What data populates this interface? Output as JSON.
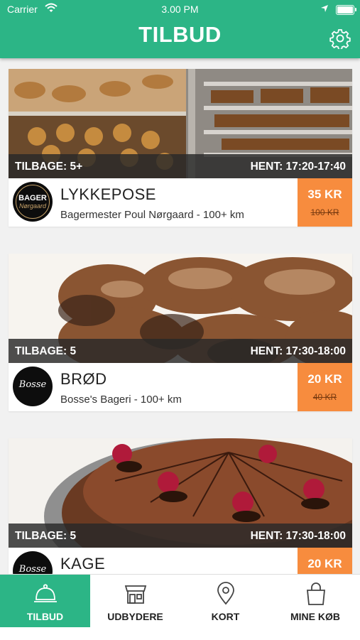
{
  "status_bar": {
    "carrier": "Carrier",
    "time": "3.00 PM"
  },
  "header": {
    "title": "TILBUD",
    "settings_icon": "gear-icon"
  },
  "colors": {
    "brand_green": "#2cb586",
    "price_orange": "#f78c3e"
  },
  "offers": [
    {
      "remaining": "TILBAGE: 5+",
      "pickup": "HENT: 17:20-17:40",
      "name": "LYKKEPOSE",
      "vendor": "Bagermester Poul Nørgaard - 100+ km",
      "logo_line1": "BAGER",
      "logo_line2": "Nørgaard",
      "price": "35 KR",
      "original_price": "100 KR"
    },
    {
      "remaining": "TILBAGE: 5",
      "pickup": "HENT: 17:30-18:00",
      "name": "BRØD",
      "vendor": "Bosse's Bageri - 100+ km",
      "logo_line1": "Bosse",
      "price": "20 KR",
      "original_price": "40 KR"
    },
    {
      "remaining": "TILBAGE: 5",
      "pickup": "HENT: 17:30-18:00",
      "name": "KAGE",
      "vendor": "",
      "logo_line1": "Bosse",
      "price": "20 KR",
      "original_price": ""
    }
  ],
  "tabs": [
    {
      "label": "TILBUD",
      "icon": "cloche-icon",
      "active": true
    },
    {
      "label": "UDBYDERE",
      "icon": "shop-icon",
      "active": false
    },
    {
      "label": "KORT",
      "icon": "map-pin-icon",
      "active": false
    },
    {
      "label": "MINE KØB",
      "icon": "shopping-bag-icon",
      "active": false
    }
  ]
}
